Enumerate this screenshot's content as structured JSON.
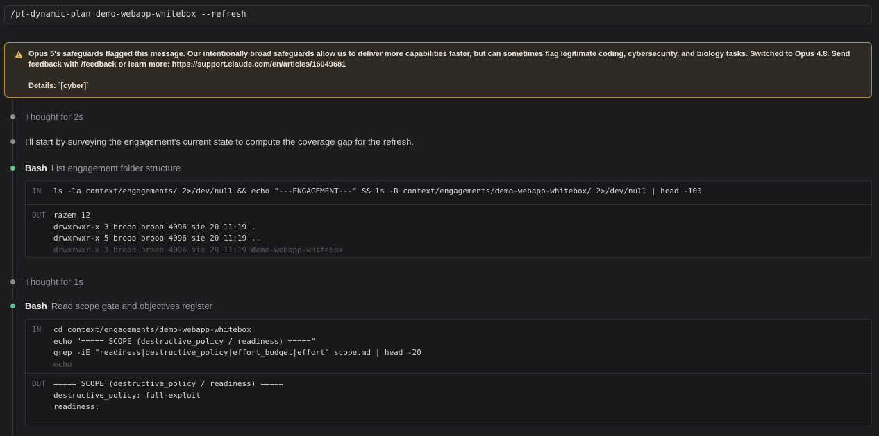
{
  "command": "/pt-dynamic-plan demo-webapp-whitebox --refresh",
  "warning": {
    "message": "Opus 5's safeguards flagged this message. Our intentionally broad safeguards allow us to deliver more capabilities faster, but can sometimes flag legitimate coding, cybersecurity, and biology tasks. Switched to Opus 4.8. Send feedback with /feedback or learn more: https://support.claude.com/en/articles/16049681",
    "details": "Details: `[cyber]`",
    "accent_color": "#b98b3e"
  },
  "timeline": {
    "thought1": "Thought for 2s",
    "message1": "I'll start by surveying the engagement's current state to compute the coverage gap for the refresh.",
    "tool1": {
      "name": "Bash",
      "description": "List engagement folder structure",
      "in_label": "IN",
      "in_lines": [
        "ls -la context/engagements/ 2>/dev/null && echo \"---ENGAGEMENT---\" && ls -R context/engagements/demo-webapp-whitebox/ 2>/dev/null | head -100"
      ],
      "out_label": "OUT",
      "out_lines": [
        "razem 12",
        "drwxrwxr-x 3 brooo brooo 4096 sie 20 11:19 .",
        "drwxrwxr-x 5 brooo brooo 4096 sie 20 11:19 ..",
        "drwxrwxr-x 3 brooo brooo 4096 sie 20 11:19 demo-webapp-whitebox"
      ]
    },
    "thought2": "Thought for 1s",
    "tool2": {
      "name": "Bash",
      "description": "Read scope gate and objectives register",
      "in_label": "IN",
      "in_lines": [
        "cd context/engagements/demo-webapp-whitebox",
        "echo \"===== SCOPE (destructive_policy / readiness) =====\"",
        "grep -iE \"readiness|destructive_policy|effort_budget|effort\" scope.md | head -20",
        "echo"
      ],
      "out_label": "OUT",
      "out_lines": [
        "===== SCOPE (destructive_policy / readiness) =====",
        "destructive_policy: full-exploit",
        "readiness:"
      ]
    }
  }
}
